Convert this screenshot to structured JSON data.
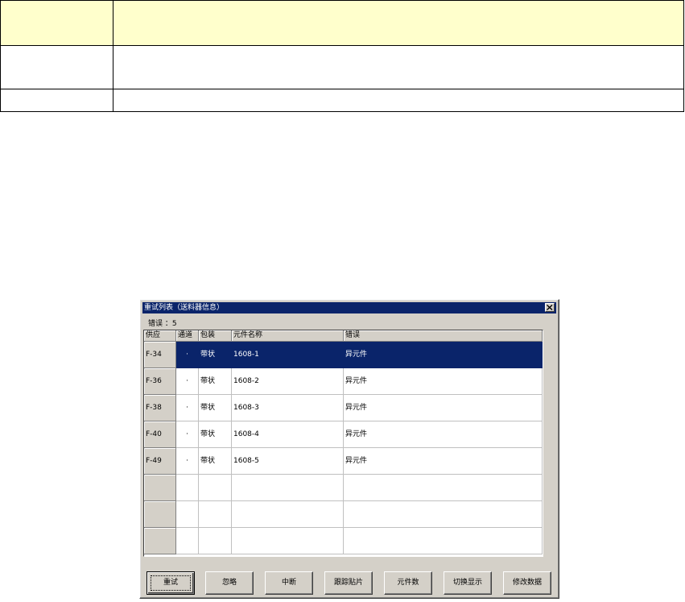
{
  "dialog": {
    "title": "重试列表（送料器信息）",
    "error_label": "错误 ：5",
    "columns": [
      "供应",
      "通道",
      "包装",
      "元件名称",
      "错误"
    ],
    "rows": [
      {
        "feeder": "F-34",
        "channel": "·",
        "package": "带状",
        "name": "1608-1",
        "error": "异元件",
        "selected": true
      },
      {
        "feeder": "F-36",
        "channel": "·",
        "package": "带状",
        "name": "1608-2",
        "error": "异元件",
        "selected": false
      },
      {
        "feeder": "F-38",
        "channel": "·",
        "package": "带状",
        "name": "1608-3",
        "error": "异元件",
        "selected": false
      },
      {
        "feeder": "F-40",
        "channel": "·",
        "package": "带状",
        "name": "1608-4",
        "error": "异元件",
        "selected": false
      },
      {
        "feeder": "F-49",
        "channel": "·",
        "package": "带状",
        "name": "1608-5",
        "error": "异元件",
        "selected": false
      },
      {
        "feeder": "",
        "channel": "",
        "package": "",
        "name": "",
        "error": "",
        "selected": false
      },
      {
        "feeder": "",
        "channel": "",
        "package": "",
        "name": "",
        "error": "",
        "selected": false
      },
      {
        "feeder": "",
        "channel": "",
        "package": "",
        "name": "",
        "error": "",
        "selected": false
      }
    ],
    "buttons": [
      "重试",
      "忽略",
      "中断",
      "跟踪贴片",
      "元件数",
      "切换显示",
      "修改数据"
    ]
  },
  "colors": {
    "title_bar": "#0a246a",
    "selection": "#0a246a",
    "doc_header_fill": "#ffffcc",
    "window_face": "#d4d0c8"
  }
}
